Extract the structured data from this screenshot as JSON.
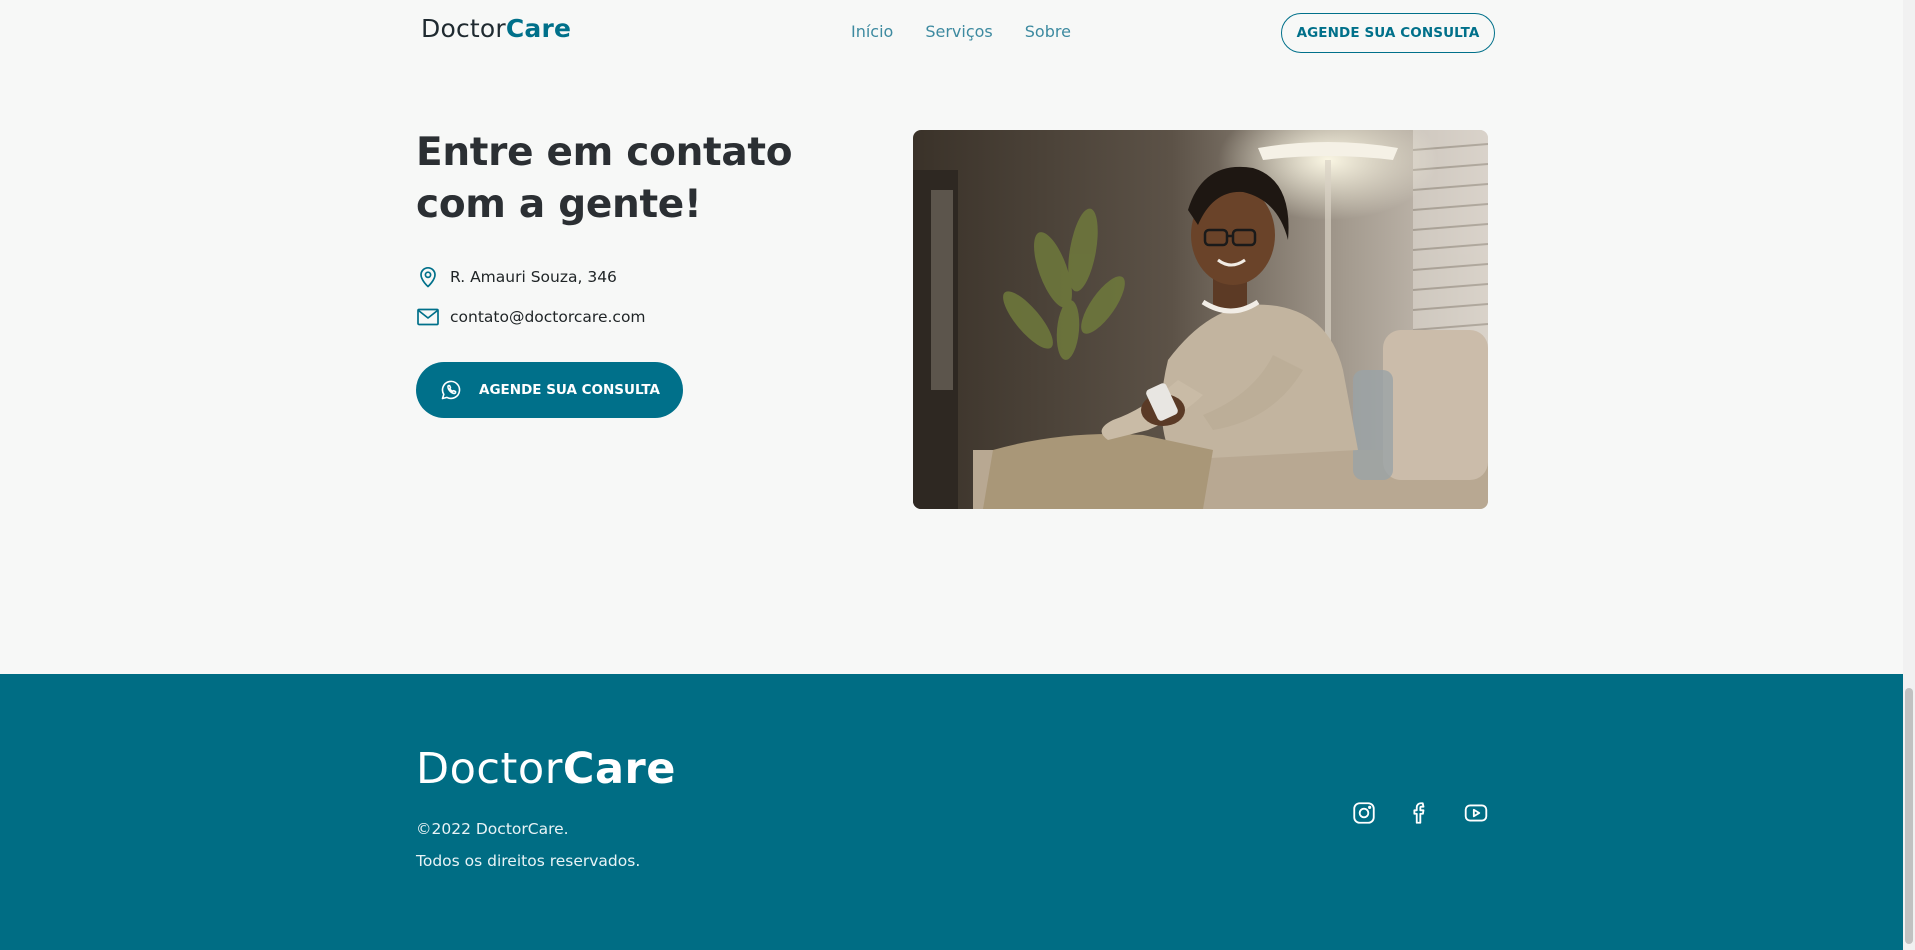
{
  "header": {
    "logo_prefix": "Doctor",
    "logo_suffix": "Care",
    "nav": [
      "Início",
      "Serviços",
      "Sobre"
    ],
    "cta_label": "AGENDE SUA CONSULTA"
  },
  "contact": {
    "title": "Entre em contato com a gente!",
    "address": "R. Amauri Souza, 346",
    "email": "contato@doctorcare.com",
    "cta_label": "AGENDE SUA CONSULTA"
  },
  "footer": {
    "logo_prefix": "Doctor",
    "logo_suffix": "Care",
    "copyright": "©2022 DoctorCare.",
    "rights": "Todos os direitos reservados.",
    "socials": [
      "instagram-icon",
      "facebook-icon",
      "youtube-icon"
    ]
  },
  "colors": {
    "brand": "#00708a",
    "footer_bg": "#006d84",
    "page_bg": "#f7f8f7"
  }
}
